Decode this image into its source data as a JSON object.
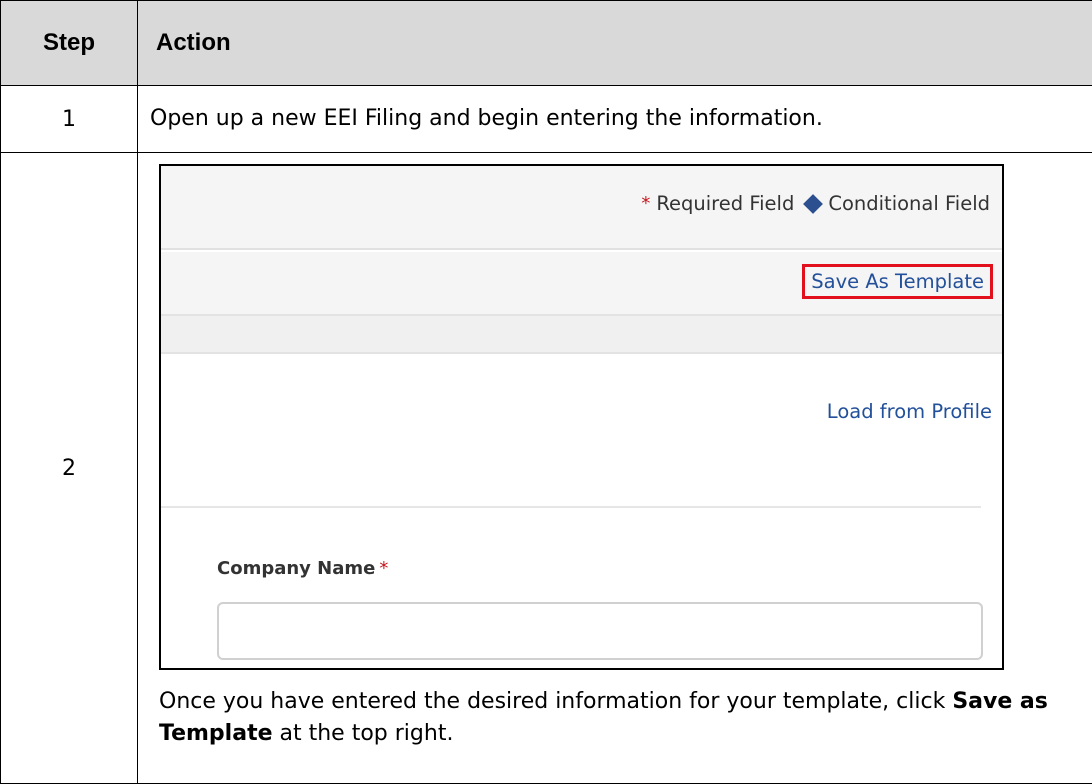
{
  "table": {
    "header_step": "Step",
    "header_action": "Action"
  },
  "rows": [
    {
      "step": "1",
      "text": "Open up a new EEI Filing and begin entering the information."
    },
    {
      "step": "2",
      "screenshot": {
        "required_star": "*",
        "required_label": "Required Field",
        "conditional_label": "Conditional Field",
        "save_as_template": "Save As Template",
        "load_from_profile": "Load from Profile",
        "company_name_label": "Company Name",
        "company_name_value": "",
        "accent_colors": {
          "link": "#23509a",
          "highlight": "#e2101c",
          "required": "#c4161c",
          "diamond": "#2b4f8f"
        }
      },
      "instruction_pre": "Once you have entered the desired information for your template, click ",
      "instruction_bold": "Save as Template",
      "instruction_post": " at the top right."
    }
  ]
}
